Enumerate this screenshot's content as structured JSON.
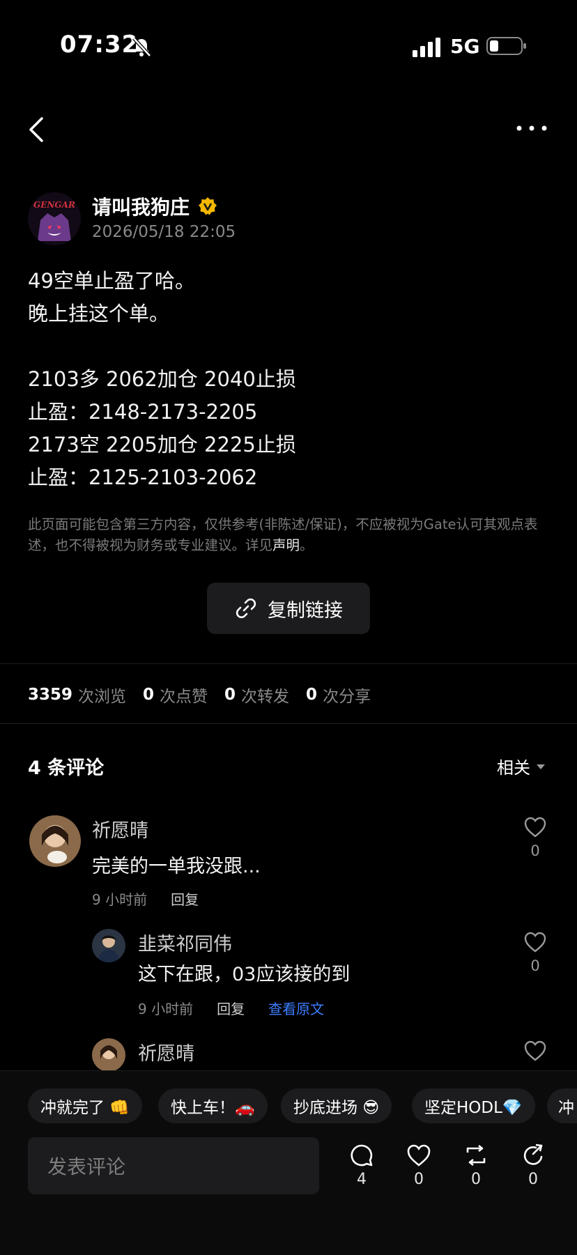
{
  "status_bar": {
    "time": "07:32",
    "network": "5G",
    "icons": [
      "bell-muted-icon",
      "signal-icon",
      "battery-icon"
    ]
  },
  "header": {
    "back_icon": "chevron-left-icon",
    "more_icon": "more-dots-icon"
  },
  "post": {
    "author": "请叫我狗庄",
    "timestamp": "2026/05/18 22:05",
    "avatar_logo_text": "GENGAR",
    "content": "49空单止盈了哈。\n晚上挂这个单。\n\n2103多 2062加仓 2040止损\n止盈：2148-2173-2205\n2173空 2205加仓 2225止损\n止盈：2125-2103-2062",
    "disclaimer_text": "此页面可能包含第三方内容，仅供参考(非陈述/保证)，不应被视为Gate认可其观点表述，也不得被视为财务或专业建议。详见",
    "disclaimer_link": "声明",
    "disclaimer_end": "。",
    "copy_link_label": "复制链接"
  },
  "stats": {
    "views": "3359",
    "views_label": "次浏览",
    "likes": "0",
    "likes_label": "次点赞",
    "reposts": "0",
    "reposts_label": "次转发",
    "shares": "0",
    "shares_label": "次分享"
  },
  "comments_section": {
    "title": "4 条评论",
    "sort_label": "相关",
    "comments": [
      {
        "name": "祈愿晴",
        "text": "完美的一单我没跟...",
        "time": "9 小时前",
        "reply_label": "回复",
        "likes": "0"
      },
      {
        "name": "韭菜祁同伟",
        "text": "这下在跟，03应该接的到",
        "time": "9 小时前",
        "reply_label": "回复",
        "view_original": "查看原文",
        "likes": "0"
      },
      {
        "name": "祈愿晴"
      }
    ]
  },
  "quick_replies": [
    "冲就完了 👊",
    "快上车！🚗",
    "抄底进场 😎",
    "坚定HODL💎",
    "冲"
  ],
  "composer": {
    "placeholder": "发表评论",
    "actions": [
      {
        "icon": "comment-icon",
        "count": "4"
      },
      {
        "icon": "heart-icon",
        "count": "0"
      },
      {
        "icon": "repost-icon",
        "count": "0"
      },
      {
        "icon": "share-icon",
        "count": "0"
      }
    ]
  },
  "colors": {
    "background": "#000000",
    "accent_link": "#3d7dff",
    "verified_badge": "#f5b800",
    "surface": "#1c1c1e"
  }
}
